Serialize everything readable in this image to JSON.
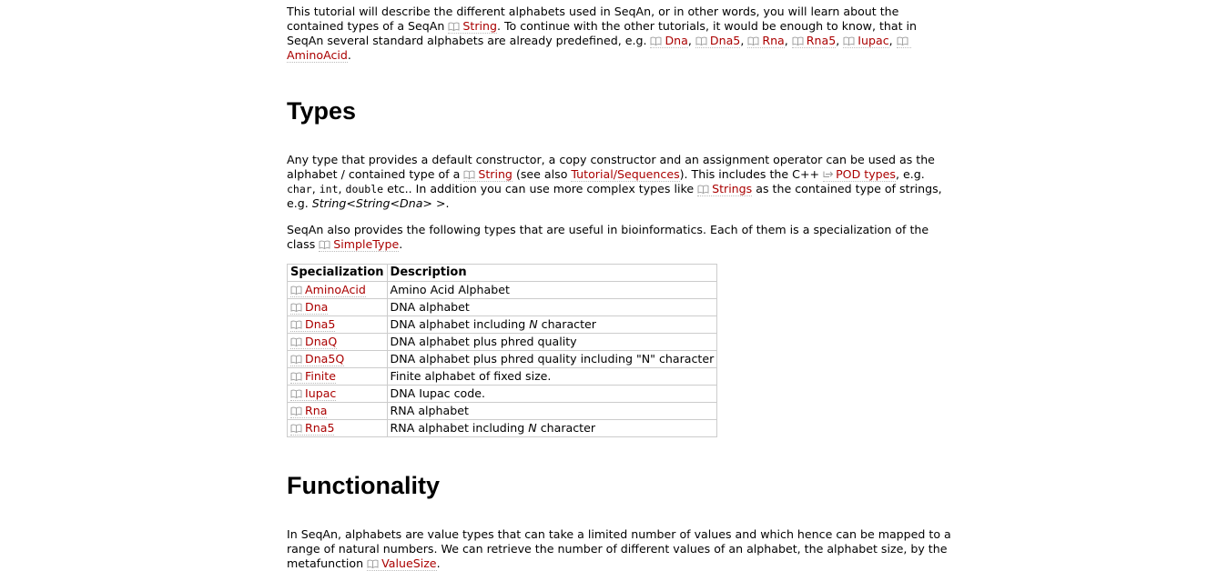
{
  "intro": {
    "t1": "This tutorial will describe the different alphabets used in SeqAn, or in other words, you will learn about the contained types of a SeqAn ",
    "link_string": "String",
    "t2": ". To continue with the other tutorials, it would be enough to know, that in SeqAn several standard alphabets are already predefined, e.g. ",
    "link_dna": "Dna",
    "sep1": ", ",
    "link_dna5": "Dna5",
    "sep2": ", ",
    "link_rna": "Rna",
    "sep3": ", ",
    "link_rna5": "Rna5",
    "sep4": ", ",
    "link_iupac": "Iupac",
    "sep5": ", ",
    "link_aminoacid": "AminoAcid",
    "t3": "."
  },
  "types_section": {
    "heading": "Types",
    "p1": {
      "t1": "Any type that provides a default constructor, a copy constructor and an assignment operator can be used as the alphabet / contained type of a ",
      "link_string": "String",
      "t2": " (see also ",
      "link_tutorial": "Tutorial/Sequences",
      "t3": "). This includes the C++ ",
      "link_pod": "POD types",
      "t4": ", e.g. ",
      "code_char": "char",
      "t5": ", ",
      "code_int": "int",
      "t6": ", ",
      "code_double": "double",
      "t7": " etc.. In addition you can use more complex types like ",
      "link_strings": "Strings",
      "t8": " as the contained type of strings, e.g. ",
      "em_example": "String<String<Dna> >",
      "t9": "."
    },
    "p2": {
      "t1": "SeqAn also provides the following types that are useful in bioinformatics. Each of them is a specialization of the class ",
      "link_simpletype": "SimpleType",
      "t2": "."
    },
    "table": {
      "headers": [
        "Specialization",
        "Description"
      ],
      "rows": [
        {
          "spec": "AminoAcid",
          "desc": "Amino Acid Alphabet"
        },
        {
          "spec": "Dna",
          "desc": "DNA alphabet"
        },
        {
          "spec": "Dna5",
          "desc_pre": "DNA alphabet including ",
          "desc_em": "N",
          "desc_post": " character"
        },
        {
          "spec": "DnaQ",
          "desc": "DNA alphabet plus phred quality"
        },
        {
          "spec": "Dna5Q",
          "desc": "DNA alphabet plus phred quality including \"N\" character"
        },
        {
          "spec": "Finite",
          "desc": "Finite alphabet of fixed size."
        },
        {
          "spec": "Iupac",
          "desc": "DNA Iupac code."
        },
        {
          "spec": "Rna",
          "desc": "RNA alphabet"
        },
        {
          "spec": "Rna5",
          "desc_pre": "RNA alphabet including ",
          "desc_em": "N",
          "desc_post": " character"
        }
      ]
    }
  },
  "functionality_section": {
    "heading": "Functionality",
    "p1": {
      "t1": "In SeqAn, alphabets are value types that can take a limited number of values and which hence can be mapped to a range of natural numbers. We can retrieve the number of different values of an alphabet, the alphabet size, by the metafunction ",
      "link_valuesize": "ValueSize",
      "t2": "."
    }
  },
  "icons": {
    "doc_link": "book-icon",
    "external_link": "external-link-icon"
  },
  "colors": {
    "link": "#aa0000",
    "table_border": "#cccccc"
  }
}
